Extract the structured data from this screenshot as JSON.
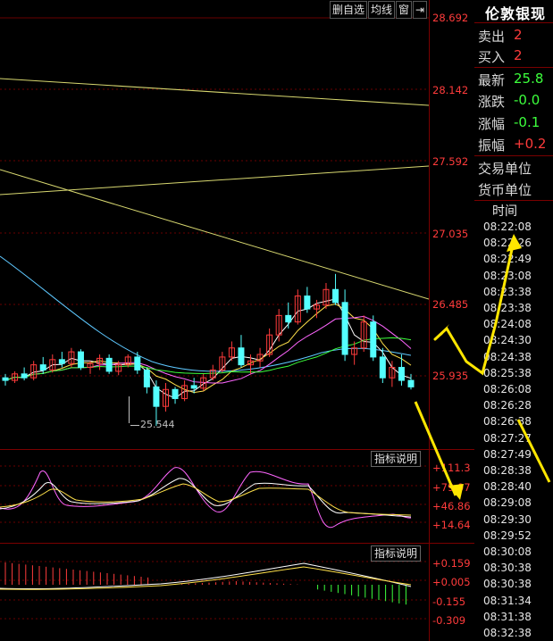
{
  "toolbar": {
    "delete_watch": "删自选",
    "ma_lines": "均线",
    "window": "窗",
    "arrow": "⇥"
  },
  "price_axis": [
    "28.692",
    "28.142",
    "27.592",
    "27.035",
    "26.485",
    "25.935"
  ],
  "low_marker": "25.544",
  "indicator1": {
    "button": "指标说明",
    "ticks": [
      "+111.3",
      "+79.07",
      "+46.86",
      "+14.64"
    ]
  },
  "indicator2": {
    "button": "指标说明",
    "ticks": [
      "+0.159",
      "+0.005",
      "-0.155",
      "-0.309"
    ]
  },
  "info": {
    "title": "伦敦银现",
    "sell_label": "卖出",
    "sell_value": "2",
    "buy_label": "买入",
    "buy_value": "2",
    "last_label": "最新",
    "last_value": "25.8",
    "change_label": "涨跌",
    "change_value": "-0.0",
    "pct_label": "涨幅",
    "pct_value": "-0.1",
    "amp_label": "振幅",
    "amp_value": "+0.2",
    "unit_label": "交易单位",
    "currency_label": "货币单位",
    "time_head": "时间",
    "times": [
      "08:22:08",
      "08:22:26",
      "08:22:49",
      "08:23:08",
      "08:23:38",
      "08:23:38",
      "08:24:08",
      "08:24:30",
      "08:24:38",
      "08:25:38",
      "08:26:08",
      "08:26:28",
      "08:26:38",
      "08:27:27",
      "08:27:49",
      "08:28:38",
      "08:28:40",
      "08:29:08",
      "08:29:30",
      "08:29:52",
      "08:30:08",
      "08:30:38",
      "08:30:38",
      "08:31:34",
      "08:31:38",
      "08:32:38"
    ]
  },
  "colors": {
    "up": "#ff3b3b",
    "down": "#54ffff",
    "ma_yellow": "#e8e86a",
    "arrow": "#ffe600"
  },
  "chart_data": {
    "type": "candlestick",
    "ylim": [
      25.4,
      28.692
    ],
    "candles": [
      [
        25.92,
        25.95,
        25.86,
        25.9
      ],
      [
        25.9,
        25.97,
        25.88,
        25.95
      ],
      [
        25.95,
        26.0,
        25.9,
        25.92
      ],
      [
        25.92,
        26.05,
        25.9,
        26.02
      ],
      [
        26.02,
        26.08,
        25.95,
        25.98
      ],
      [
        25.98,
        26.1,
        25.96,
        26.06
      ],
      [
        26.06,
        26.12,
        26.0,
        26.03
      ],
      [
        26.03,
        26.15,
        26.0,
        26.12
      ],
      [
        26.12,
        26.14,
        25.98,
        26.0
      ],
      [
        26.0,
        26.05,
        25.95,
        26.03
      ],
      [
        26.03,
        26.1,
        25.98,
        26.07
      ],
      [
        26.07,
        26.1,
        25.95,
        25.97
      ],
      [
        25.97,
        26.05,
        25.94,
        26.02
      ],
      [
        26.02,
        26.1,
        26.0,
        26.08
      ],
      [
        26.08,
        26.12,
        25.95,
        25.98
      ],
      [
        25.98,
        26.0,
        25.8,
        25.85
      ],
      [
        25.85,
        25.9,
        25.55,
        25.7
      ],
      [
        25.7,
        25.88,
        25.66,
        25.83
      ],
      [
        25.83,
        25.85,
        25.72,
        25.76
      ],
      [
        25.76,
        25.9,
        25.74,
        25.86
      ],
      [
        25.86,
        25.92,
        25.8,
        25.84
      ],
      [
        25.84,
        25.95,
        25.82,
        25.92
      ],
      [
        25.92,
        26.02,
        25.9,
        25.98
      ],
      [
        25.98,
        26.12,
        25.96,
        26.08
      ],
      [
        26.08,
        26.2,
        26.05,
        26.15
      ],
      [
        26.15,
        26.25,
        26.0,
        26.02
      ],
      [
        26.02,
        26.1,
        25.95,
        26.05
      ],
      [
        26.05,
        26.15,
        26.0,
        26.1
      ],
      [
        26.1,
        26.3,
        26.08,
        26.25
      ],
      [
        26.25,
        26.45,
        26.2,
        26.4
      ],
      [
        26.4,
        26.5,
        26.3,
        26.35
      ],
      [
        26.35,
        26.6,
        26.33,
        26.55
      ],
      [
        26.55,
        26.62,
        26.42,
        26.45
      ],
      [
        26.45,
        26.52,
        26.38,
        26.48
      ],
      [
        26.48,
        26.65,
        26.45,
        26.6
      ],
      [
        26.6,
        26.72,
        26.48,
        26.5
      ],
      [
        26.5,
        26.6,
        26.05,
        26.1
      ],
      [
        26.1,
        26.2,
        26.02,
        26.15
      ],
      [
        26.15,
        26.4,
        26.12,
        26.35
      ],
      [
        26.35,
        26.4,
        26.05,
        26.08
      ],
      [
        26.08,
        26.15,
        25.88,
        25.92
      ],
      [
        25.92,
        26.05,
        25.85,
        26.0
      ],
      [
        26.0,
        26.1,
        25.86,
        25.9
      ],
      [
        25.9,
        25.95,
        25.83,
        25.85
      ]
    ]
  }
}
